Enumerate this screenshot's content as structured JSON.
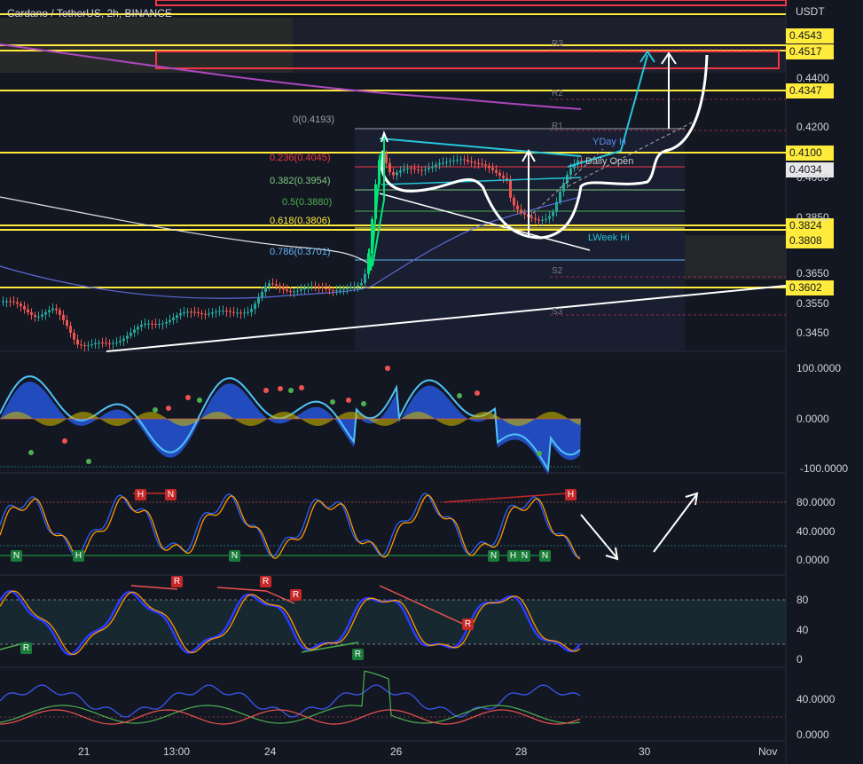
{
  "header": {
    "title": "Cardano / TetherUS, 2h, BINANCE",
    "unit": "USDT"
  },
  "price_tags": [
    {
      "label": "0.4543",
      "style": "yellow"
    },
    {
      "label": "0.4517",
      "style": "yellow"
    },
    {
      "label": "0.4347",
      "style": "yellow"
    },
    {
      "label": "0.4100",
      "style": "yellow"
    },
    {
      "label": "0.4034",
      "style": "white"
    },
    {
      "label": "0.3824",
      "style": "yellow"
    },
    {
      "label": "0.3808",
      "style": "yellow"
    },
    {
      "label": "0.3602",
      "style": "yellow"
    }
  ],
  "price_scale": [
    "0.4400",
    "0.4200",
    "0.4000",
    "0.3850",
    "0.3650",
    "0.3550",
    "0.3450"
  ],
  "fib_levels": [
    {
      "label": "0(0.4193)",
      "color": "#9aa0a6"
    },
    {
      "label": "0.236(0.4045)",
      "color": "#f23645"
    },
    {
      "label": "0.382(0.3954)",
      "color": "#81c784"
    },
    {
      "label": "0.5(0.3880)",
      "color": "#4caf50"
    },
    {
      "label": "0.618(0.3806)",
      "color": "#ffeb3b"
    },
    {
      "label": "0.786(0.3701)",
      "color": "#64b5f6"
    }
  ],
  "pivot_labels": {
    "r3": "R3",
    "r2": "R2",
    "r1": "R1",
    "s2": "S2",
    "s3": "S3",
    "yday_hi": "YDay H",
    "daily_open": "Daily Open",
    "lweek_hi": "LWeek Hi"
  },
  "osc1_scale": [
    "100.0000",
    "0.0000",
    "-100.0000"
  ],
  "osc2_scale": [
    "80.0000",
    "40.0000",
    "0.0000"
  ],
  "osc2_badges": [
    "H",
    "N",
    "N",
    "H",
    "N",
    "N",
    "H",
    "N",
    "N",
    "N",
    "H"
  ],
  "osc3_scale": [
    "80",
    "40",
    "0"
  ],
  "osc3_badges": [
    "R",
    "R",
    "R",
    "R",
    "R",
    "R",
    "R",
    "R"
  ],
  "osc4_scale": [
    "40.0000",
    "0.0000"
  ],
  "x_axis": [
    "21",
    "13:00",
    "24",
    "26",
    "28",
    "30",
    "Nov"
  ],
  "colors": {
    "bg": "#131722",
    "up": "#26a69a",
    "down": "#ef5350",
    "level": "#ffeb3b",
    "bright_green": "#00e676",
    "cyan": "#26c6da",
    "red_box": "#f23645"
  }
}
